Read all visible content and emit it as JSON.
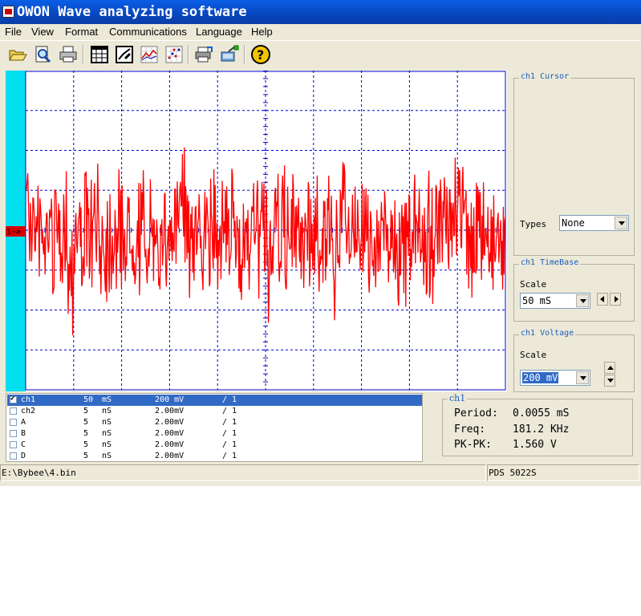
{
  "window": {
    "title": "OWON Wave analyzing software"
  },
  "menu": {
    "items": [
      "File",
      "View",
      "Format",
      "Communications",
      "Language",
      "Help"
    ]
  },
  "toolbar": {
    "icons": [
      "open-folder-icon",
      "print-preview-icon",
      "print-icon",
      "table-icon",
      "edit-chart-icon",
      "waveform-chart-icon",
      "scatter-chart-icon",
      "export-icon",
      "connect-device-icon",
      "help-icon"
    ]
  },
  "scope": {
    "channel_marker": "1->",
    "trace_color": "#ff0000",
    "grid_color": "#0000cc",
    "left_strip_color": "#00e0f0"
  },
  "channel_list": {
    "rows": [
      {
        "checked": true,
        "name": "ch1",
        "time": "50",
        "time_unit": "mS",
        "volt": "200 mV",
        "probe": "/ 1"
      },
      {
        "checked": false,
        "name": "ch2",
        "time": "5",
        "time_unit": "nS",
        "volt": "2.00mV",
        "probe": "/ 1"
      },
      {
        "checked": false,
        "name": "A",
        "time": "5",
        "time_unit": "nS",
        "volt": "2.00mV",
        "probe": "/ 1"
      },
      {
        "checked": false,
        "name": "B",
        "time": "5",
        "time_unit": "nS",
        "volt": "2.00mV",
        "probe": "/ 1"
      },
      {
        "checked": false,
        "name": "C",
        "time": "5",
        "time_unit": "nS",
        "volt": "2.00mV",
        "probe": "/ 1"
      },
      {
        "checked": false,
        "name": "D",
        "time": "5",
        "time_unit": "nS",
        "volt": "2.00mV",
        "probe": "/ 1"
      }
    ]
  },
  "measurements": {
    "legend": "ch1",
    "period_label": "Period:",
    "period_value": "0.0055 mS",
    "freq_label": "Freq:",
    "freq_value": "181.2 KHz",
    "pkpk_label": "PK-PK:",
    "pkpk_value": "1.560 V"
  },
  "cursor": {
    "legend": "ch1 Cursor",
    "types_label": "Types",
    "types_value": "None"
  },
  "timebase": {
    "legend": "ch1 TimeBase",
    "scale_label": "Scale",
    "scale_value": "50 mS"
  },
  "voltage": {
    "legend": "ch1 Voltage",
    "scale_label": "Scale",
    "scale_value": "200 mV"
  },
  "status": {
    "file_path": "E:\\Bybee\\4.bin",
    "device": "PDS 5022S"
  }
}
